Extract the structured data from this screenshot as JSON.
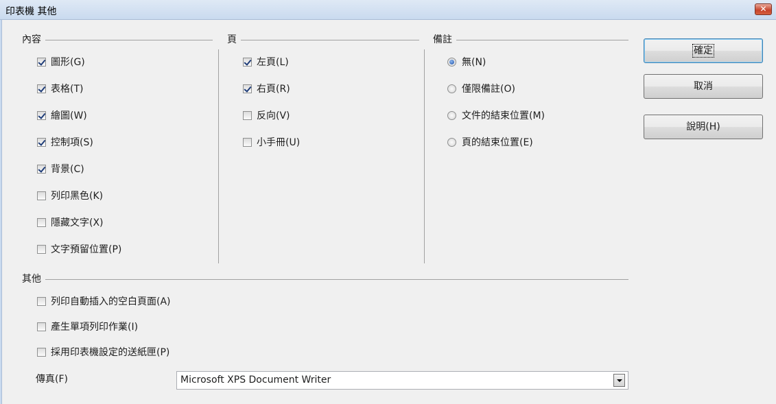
{
  "window": {
    "title": "印表機 其他",
    "close_label": "✕"
  },
  "contents": {
    "label": "內容",
    "items": [
      {
        "label": "圖形(G)",
        "checked": true
      },
      {
        "label": "表格(T)",
        "checked": true
      },
      {
        "label": "繪圖(W)",
        "checked": true
      },
      {
        "label": "控制項(S)",
        "checked": true
      },
      {
        "label": "背景(C)",
        "checked": true
      },
      {
        "label": "列印黑色(K)",
        "checked": false
      },
      {
        "label": "隱藏文字(X)",
        "checked": false
      },
      {
        "label": "文字預留位置(P)",
        "checked": false
      }
    ]
  },
  "pages": {
    "label": "頁",
    "items": [
      {
        "label": "左頁(L)",
        "checked": true
      },
      {
        "label": "右頁(R)",
        "checked": true
      },
      {
        "label": "反向(V)",
        "checked": false
      },
      {
        "label": "小手冊(U)",
        "checked": false
      }
    ]
  },
  "comments": {
    "label": "備註",
    "items": [
      {
        "label": "無(N)",
        "selected": true
      },
      {
        "label": "僅限備註(O)",
        "selected": false
      },
      {
        "label": "文件的結束位置(M)",
        "selected": false
      },
      {
        "label": "頁的結束位置(E)",
        "selected": false
      }
    ]
  },
  "other": {
    "label": "其他",
    "items": [
      {
        "label": "列印自動插入的空白頁面(A)",
        "checked": false
      },
      {
        "label": "產生單項列印作業(I)",
        "checked": false
      },
      {
        "label": "採用印表機設定的送紙匣(P)",
        "checked": false
      }
    ],
    "fax_label": "傳真(F)",
    "fax_value": "Microsoft XPS Document Writer"
  },
  "buttons": {
    "ok": "確定",
    "cancel": "取消",
    "help": "說明(H)"
  }
}
